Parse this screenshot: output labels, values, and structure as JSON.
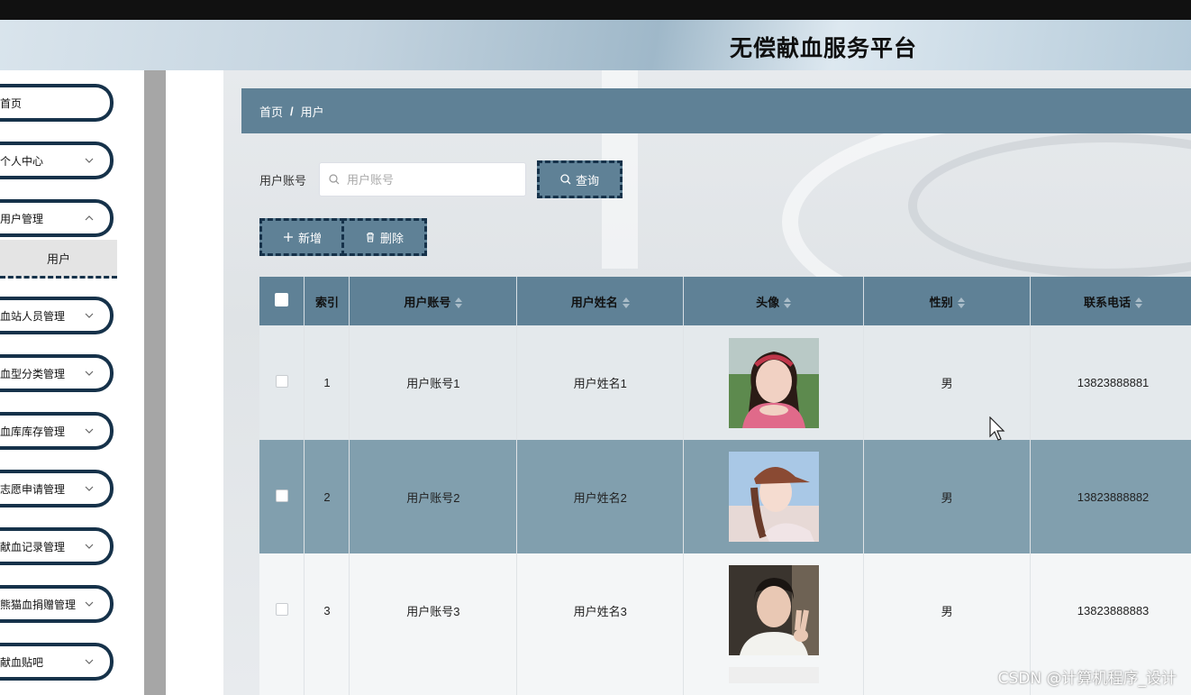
{
  "app": {
    "title": "无偿献血服务平台"
  },
  "sidebar": {
    "items": [
      {
        "label": "首页",
        "has_chevron": false
      },
      {
        "label": "个人中心",
        "has_chevron": true
      },
      {
        "label": "用户管理",
        "has_chevron": true
      },
      {
        "label": "血站人员管理",
        "has_chevron": true
      },
      {
        "label": "血型分类管理",
        "has_chevron": true
      },
      {
        "label": "血库库存管理",
        "has_chevron": true
      },
      {
        "label": "志愿申请管理",
        "has_chevron": true
      },
      {
        "label": "献血记录管理",
        "has_chevron": true
      },
      {
        "label": "熊猫血捐赠管理",
        "has_chevron": true
      },
      {
        "label": "献血贴吧",
        "has_chevron": true
      }
    ],
    "submenu_active": "用户"
  },
  "breadcrumb": {
    "home": "首页",
    "separator": "/",
    "current": "用户"
  },
  "search": {
    "label": "用户账号",
    "value": "",
    "placeholder": "用户账号",
    "button_label": "查询"
  },
  "actions": {
    "add_label": "新增",
    "delete_label": "删除"
  },
  "table": {
    "headers": {
      "index": "索引",
      "account": "用户账号",
      "name": "用户姓名",
      "avatar": "头像",
      "gender": "性别",
      "phone": "联系电话"
    },
    "rows": [
      {
        "index": "1",
        "account": "用户账号1",
        "name": "用户姓名1",
        "avatar": "avatar-girl-headband",
        "gender": "男",
        "phone": "13823888881"
      },
      {
        "index": "2",
        "account": "用户账号2",
        "name": "用户姓名2",
        "avatar": "avatar-girl-cap",
        "gender": "男",
        "phone": "13823888882"
      },
      {
        "index": "3",
        "account": "用户账号3",
        "name": "用户姓名3",
        "avatar": "avatar-boy-peace",
        "gender": "男",
        "phone": "13823888883"
      }
    ]
  },
  "colors": {
    "accent": "#5f8196",
    "border_dark": "#16324a",
    "row_selected": "#819fae"
  },
  "watermark": "CSDN @计算机程序_设计"
}
